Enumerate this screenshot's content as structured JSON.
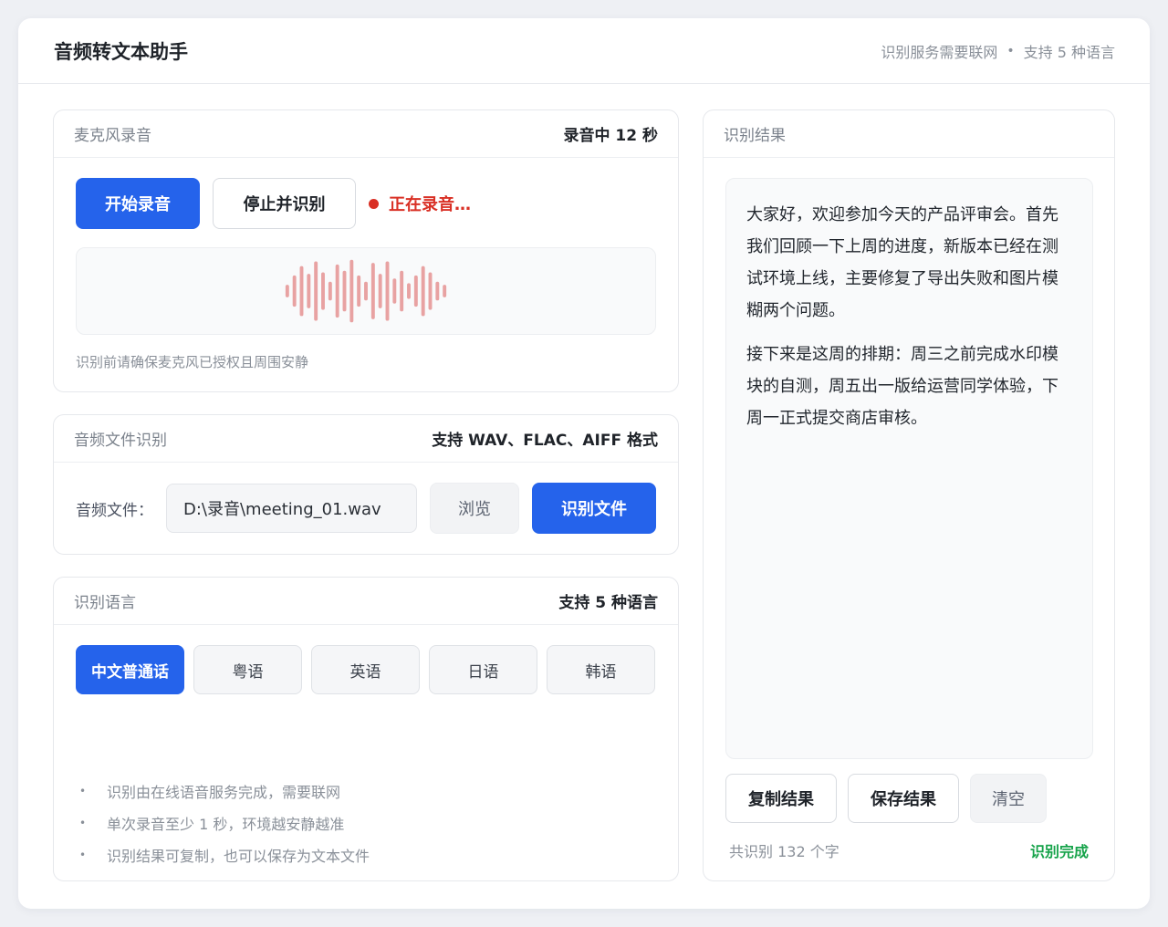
{
  "app": {
    "title": "音频转文本助手",
    "network_note": "识别服务需要联网",
    "separator": "•",
    "languages_note": "支持 5 种语言"
  },
  "mic": {
    "title": "麦克风录音",
    "status_meta": "录音中 12 秒",
    "start_label": "开始录音",
    "stop_label": "停止并识别",
    "recording_label": "正在录音…",
    "hint": "识别前请确保麦克风已授权且周围安静",
    "wave_levels": [
      0.2,
      0.5,
      0.8,
      0.55,
      0.95,
      0.6,
      0.3,
      0.85,
      0.65,
      1.0,
      0.5,
      0.3,
      0.9,
      0.55,
      0.95,
      0.4,
      0.65,
      0.25,
      0.5,
      0.8,
      0.6,
      0.3,
      0.2
    ],
    "wave_color": "#e8a2a2"
  },
  "file": {
    "title": "音频文件识别",
    "formats_meta": "支持 WAV、FLAC、AIFF 格式",
    "label": "音频文件：",
    "path_value": "D:\\录音\\meeting_01.wav",
    "browse_label": "浏览",
    "recognize_label": "识别文件"
  },
  "language": {
    "title": "识别语言",
    "meta": "支持 5 种语言",
    "options": [
      {
        "label": "中文普通话",
        "active": true
      },
      {
        "label": "粤语",
        "active": false
      },
      {
        "label": "英语",
        "active": false
      },
      {
        "label": "日语",
        "active": false
      },
      {
        "label": "韩语",
        "active": false
      }
    ],
    "tips": [
      "识别由在线语音服务完成，需要联网",
      "单次录音至少 1 秒，环境越安静越准",
      "识别结果可复制，也可以保存为文本文件"
    ],
    "bullet": "•"
  },
  "result": {
    "title": "识别结果",
    "paragraphs": [
      "大家好，欢迎参加今天的产品评审会。首先我们回顾一下上周的进度，新版本已经在测试环境上线，主要修复了导出失败和图片模糊两个问题。",
      "接下来是这周的排期：周三之前完成水印模块的自测，周五出一版给运营同学体验，下周一正式提交商店审核。"
    ],
    "copy_label": "复制结果",
    "save_label": "保存结果",
    "clear_label": "清空",
    "char_count": "共识别 132 个字",
    "status": "识别完成"
  },
  "colors": {
    "accent": "#2563eb",
    "recording": "#d93025",
    "success": "#16a34a"
  }
}
